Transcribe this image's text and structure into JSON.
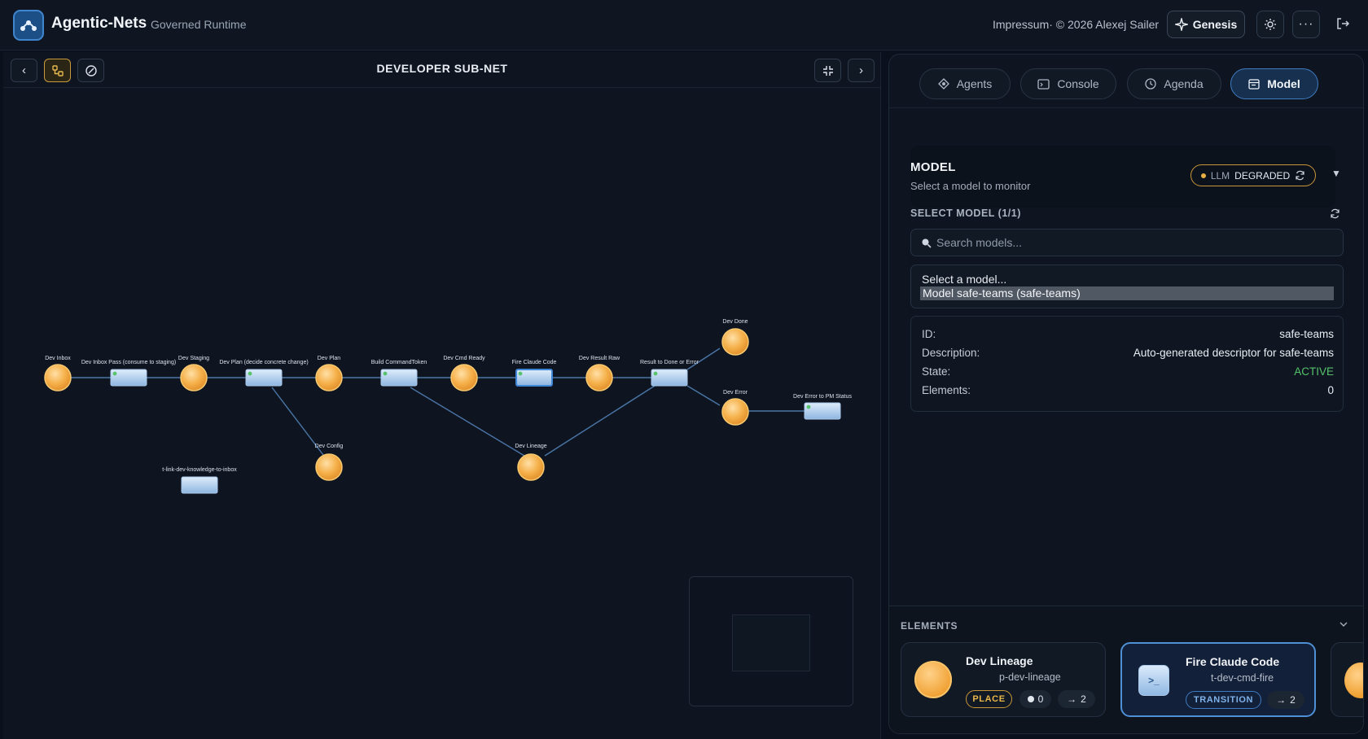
{
  "header": {
    "app_title": "Agentic-Nets",
    "app_subtitle": "Governed Runtime",
    "impressum": "Impressum· © 2026 Alexej Sailer",
    "genesis_label": "Genesis"
  },
  "canvas": {
    "title": "DEVELOPER SUB-NET",
    "places": [
      {
        "label": "Dev Inbox"
      },
      {
        "label": "Dev Staging"
      },
      {
        "label": "Dev Plan"
      },
      {
        "label": "Dev Cmd Ready"
      },
      {
        "label": "Dev Result Raw"
      },
      {
        "label": "Dev Done"
      },
      {
        "label": "Dev Error"
      },
      {
        "label": "Dev Config"
      },
      {
        "label": "Dev Lineage"
      }
    ],
    "transitions": [
      {
        "label": "Dev Inbox Pass (consume to staging)"
      },
      {
        "label": "Dev Plan (decide concrete change)"
      },
      {
        "label": "Build CommandToken"
      },
      {
        "label": "Fire Claude Code"
      },
      {
        "label": "Result to Done or Error"
      },
      {
        "label": "Dev Error to PM Status"
      },
      {
        "label": "t-link-dev-knowledge-to-inbox"
      }
    ]
  },
  "tabs": [
    {
      "label": "Agents",
      "icon": "agents-icon"
    },
    {
      "label": "Console",
      "icon": "console-icon"
    },
    {
      "label": "Agenda",
      "icon": "clock-icon"
    },
    {
      "label": "Model",
      "icon": "model-icon",
      "active": true
    }
  ],
  "model": {
    "heading": "MODEL",
    "subheading": "Select a model to monitor",
    "llm_label": "LLM",
    "llm_status": "DEGRADED",
    "select_label": "SELECT MODEL (1/1)",
    "search_placeholder": "Search models...",
    "options": [
      "Select a model...",
      "Model safe-teams (safe-teams)"
    ],
    "selected_option": "Model safe-teams (safe-teams)",
    "info": {
      "id_key": "ID:",
      "id_val": "safe-teams",
      "desc_key": "Description:",
      "desc_val": "Auto-generated descriptor for safe-teams",
      "state_key": "State:",
      "state_val": "ACTIVE",
      "elements_key": "Elements:",
      "elements_val": "0"
    }
  },
  "elements": {
    "label": "ELEMENTS",
    "cards": [
      {
        "name": "Dev Lineage",
        "id": "p-dev-lineage",
        "kind": "PLACE",
        "tokens": "0",
        "arcs": "2"
      },
      {
        "name": "Fire Claude Code",
        "id": "t-dev-cmd-fire",
        "kind": "TRANSITION",
        "arcs": "2"
      }
    ]
  },
  "colors": {
    "accent": "#3f7bc0",
    "place": "#f0a032",
    "warning": "#c99638",
    "active_state": "#55c26b"
  }
}
